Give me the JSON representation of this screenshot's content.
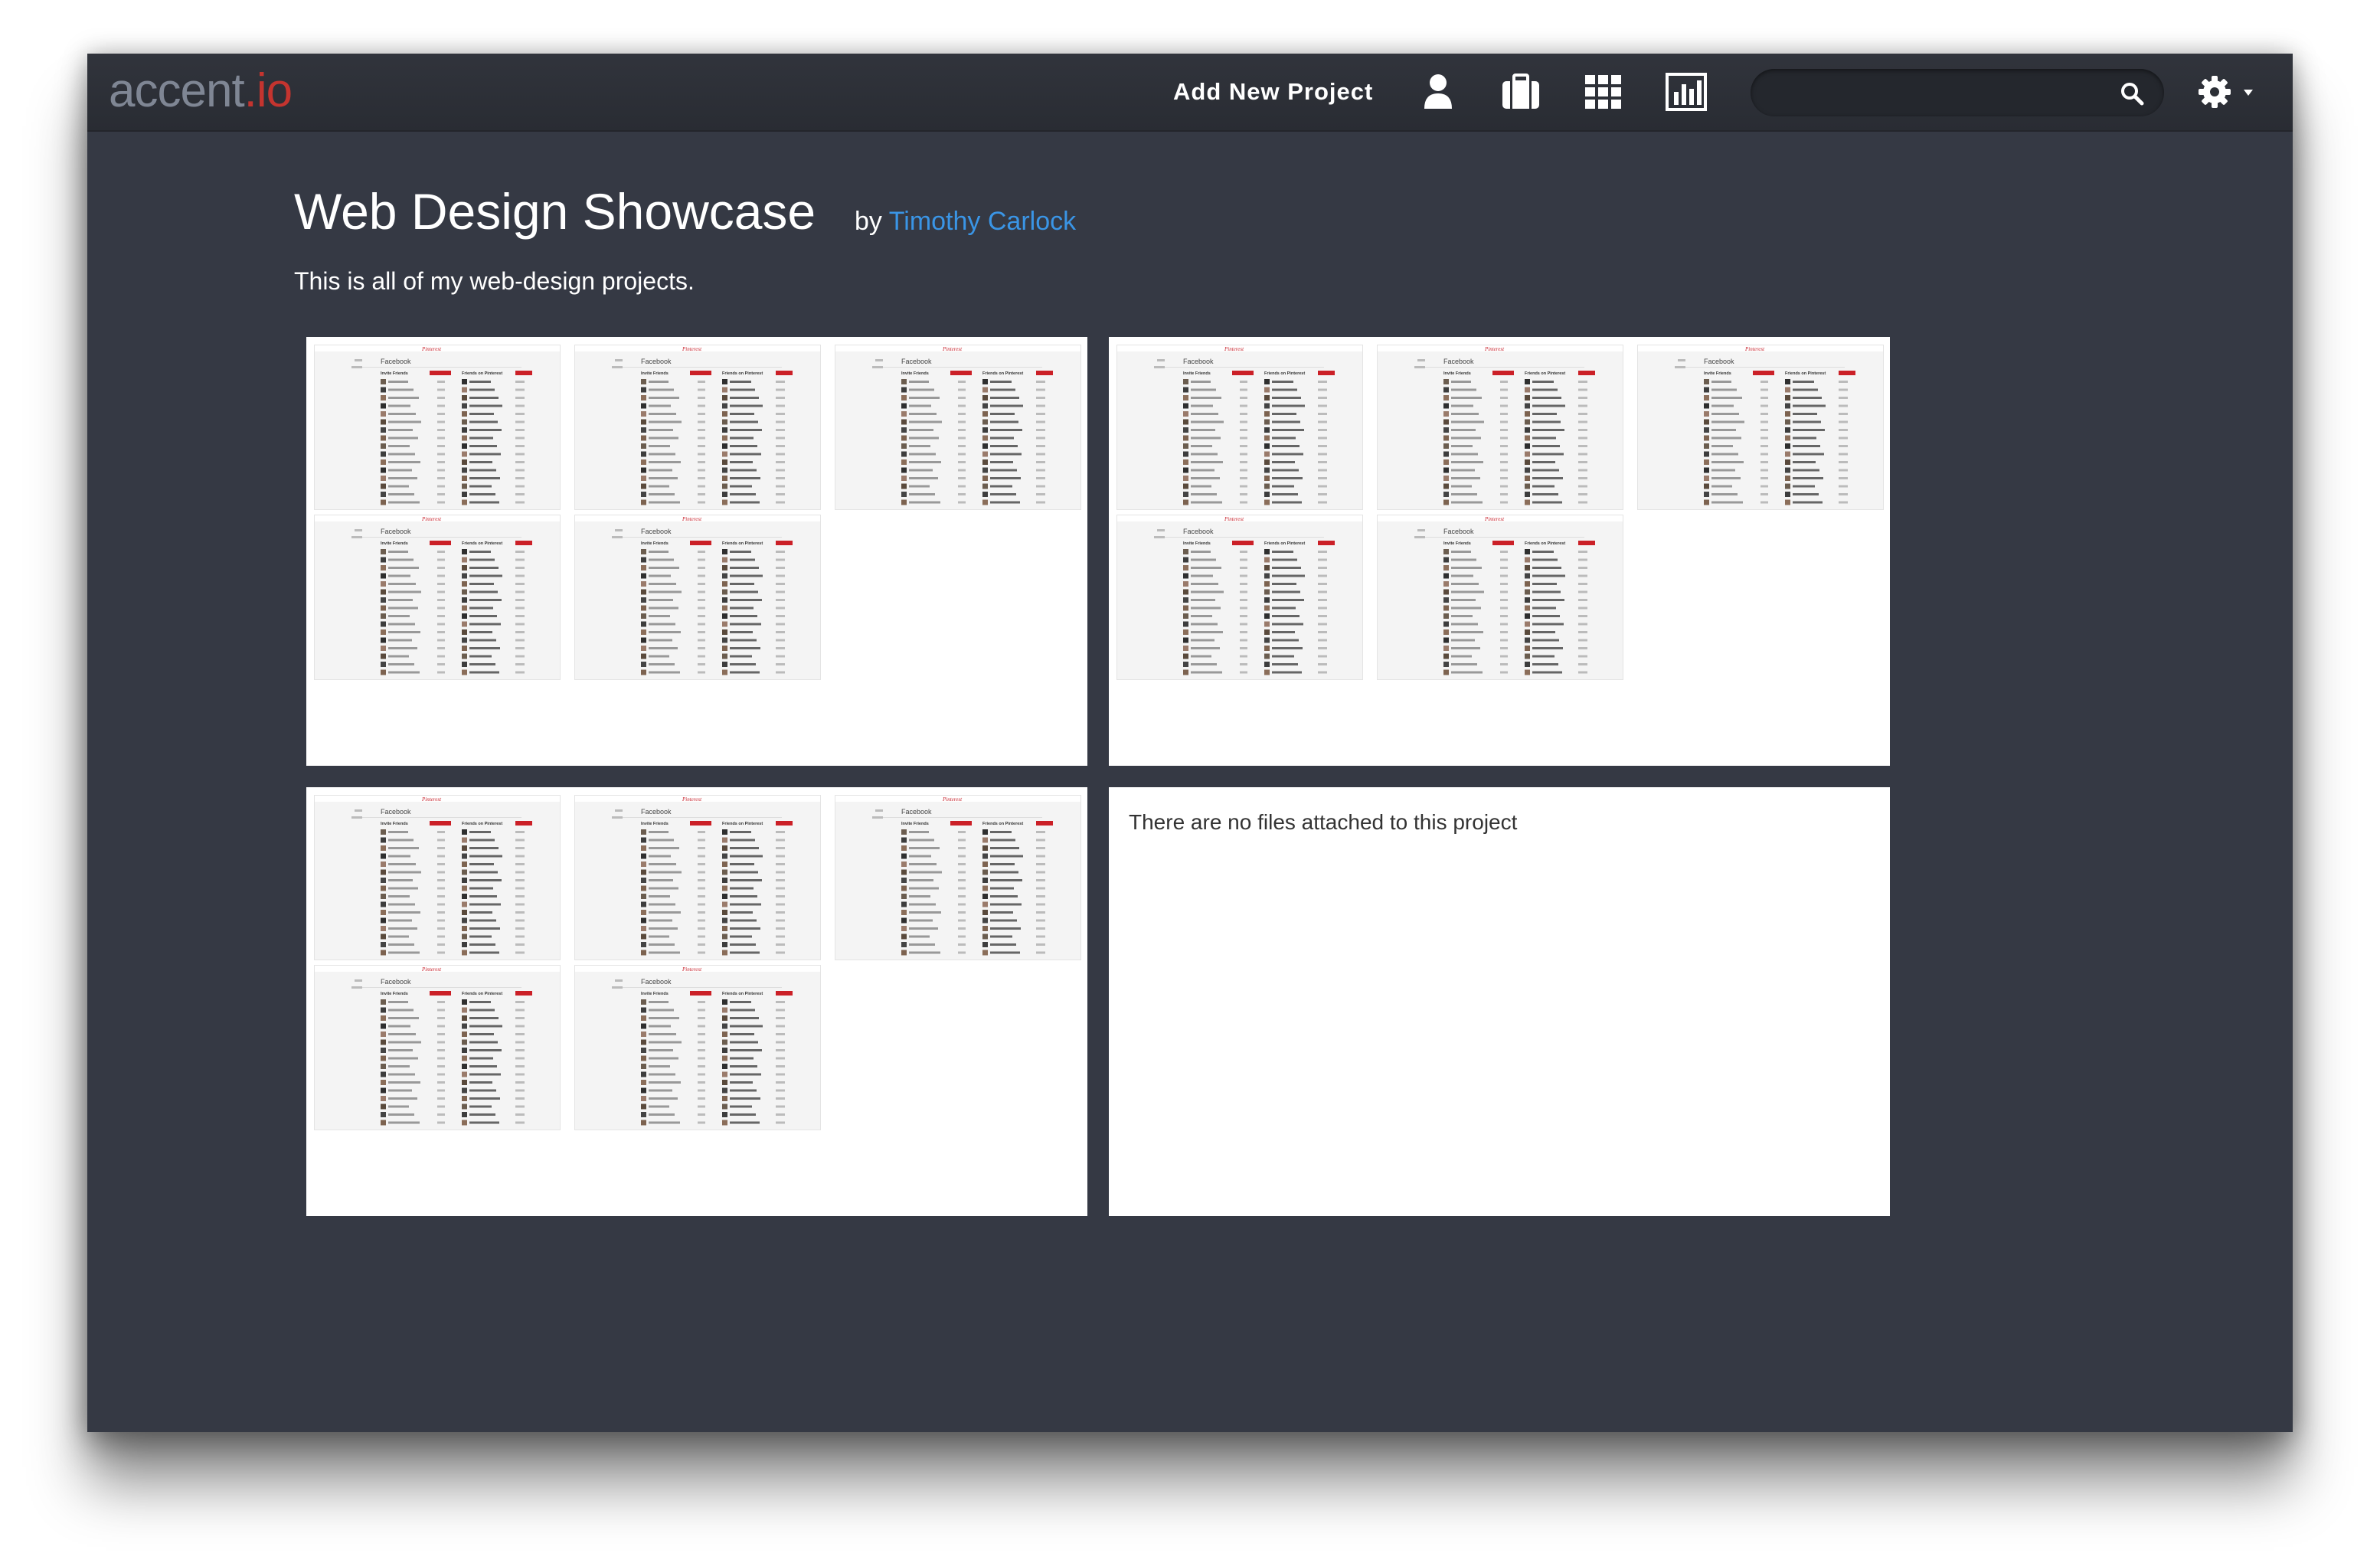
{
  "app": {
    "logo_main": "accent",
    "logo_tld": ".io",
    "brand_color": "#c4342f"
  },
  "nav": {
    "add_project": "Add New Project",
    "icons": [
      "user-icon",
      "briefcase-icon",
      "grid-icon",
      "chart-icon"
    ],
    "search_placeholder": "",
    "settings_icon": "gear-icon"
  },
  "page": {
    "title": "Web Design Showcase",
    "by": "by",
    "author": "Timothy Carlock",
    "description": "This is all of my web-design projects."
  },
  "thumbnail_text": {
    "header": "Facebook",
    "col1": "Invite Friends",
    "col2": "Friends on Pinterest",
    "brand": "Pinterest"
  },
  "projects": [
    {
      "thumbnails": 5
    },
    {
      "thumbnails": 5
    },
    {
      "thumbnails": 5
    },
    {
      "thumbnails": 0,
      "empty_message": "There are no files attached to this project"
    }
  ]
}
